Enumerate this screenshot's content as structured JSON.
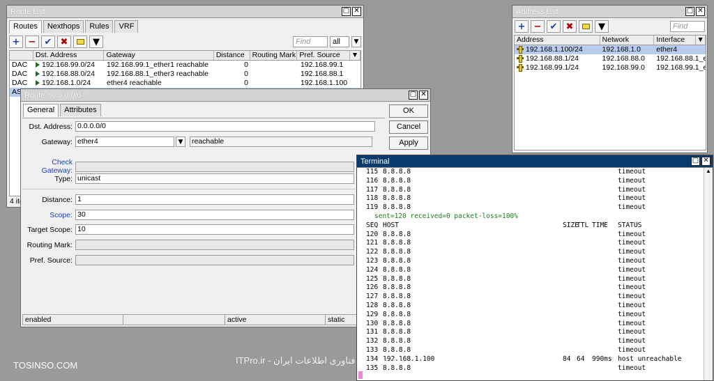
{
  "route_list": {
    "title": "Route List",
    "tabs": [
      "Routes",
      "Nexthops",
      "Rules",
      "VRF"
    ],
    "find_placeholder": "Find",
    "filter_value": "all",
    "columns": [
      "",
      "Dst. Address",
      "Gateway",
      "Distance",
      "Routing Mark",
      "Pref. Source"
    ],
    "rows": [
      {
        "flags": "DAC",
        "dst": "192.168.99.0/24",
        "gateway": "192.168.99.1_ether1 reachable",
        "distance": "0",
        "mark": "",
        "pref": "192.168.99.1"
      },
      {
        "flags": "DAC",
        "dst": "192.168.88.0/24",
        "gateway": "192.168.88.1_ether3 reachable",
        "distance": "0",
        "mark": "",
        "pref": "192.168.88.1"
      },
      {
        "flags": "DAC",
        "dst": "192.168.1.0/24",
        "gateway": "ether4 reachable",
        "distance": "0",
        "mark": "",
        "pref": "192.168.1.100"
      },
      {
        "flags": "AS",
        "dst": "",
        "gateway": "",
        "distance": "",
        "mark": "",
        "pref": ""
      }
    ],
    "item_count": "4 ite"
  },
  "route_dialog": {
    "title": "Route <0.0.0.0/0>",
    "tabs": [
      "General",
      "Attributes"
    ],
    "labels": {
      "dst": "Dst. Address:",
      "gateway": "Gateway:",
      "check_gateway": "Check Gateway:",
      "type": "Type:",
      "distance": "Distance:",
      "scope": "Scope:",
      "target_scope": "Target Scope:",
      "routing_mark": "Routing Mark:",
      "pref_source": "Pref. Source:"
    },
    "values": {
      "dst": "0.0.0.0/0",
      "gateway": "ether4",
      "gateway_state": "reachable",
      "type": "unicast",
      "distance": "1",
      "scope": "30",
      "target_scope": "10"
    },
    "buttons": {
      "ok": "OK",
      "cancel": "Cancel",
      "apply": "Apply"
    },
    "status": [
      "enabled",
      "",
      "active",
      "static"
    ]
  },
  "address_list": {
    "title": "Address List",
    "find_placeholder": "Find",
    "columns": [
      "Address",
      "Network",
      "Interface"
    ],
    "rows": [
      {
        "address": "192.168.1.100/24",
        "network": "192.168.1.0",
        "interface": "ether4"
      },
      {
        "address": "192.168.88.1/24",
        "network": "192.168.88.0",
        "interface": "192.168.88.1_e..."
      },
      {
        "address": "192.168.99.1/24",
        "network": "192.168.99.0",
        "interface": "192.168.99.1_e..."
      }
    ]
  },
  "terminal": {
    "title": "Terminal",
    "lines_before": [
      {
        "seq": "115",
        "host": "8.8.8.8",
        "status": "timeout"
      },
      {
        "seq": "116",
        "host": "8.8.8.8",
        "status": "timeout"
      },
      {
        "seq": "117",
        "host": "8.8.8.8",
        "status": "timeout"
      },
      {
        "seq": "118",
        "host": "8.8.8.8",
        "status": "timeout"
      },
      {
        "seq": "119",
        "host": "8.8.8.8",
        "status": "timeout"
      }
    ],
    "summary": "sent=120 received=0 packet-loss=100%",
    "header": {
      "seq": "SEQ",
      "host": "HOST",
      "size": "SIZE",
      "ttl": "TTL",
      "time": "TIME",
      "status": "STATUS"
    },
    "lines_after": [
      {
        "seq": "120",
        "host": "8.8.8.8",
        "size": "",
        "ttl": "",
        "time": "",
        "status": "timeout"
      },
      {
        "seq": "121",
        "host": "8.8.8.8",
        "size": "",
        "ttl": "",
        "time": "",
        "status": "timeout"
      },
      {
        "seq": "122",
        "host": "8.8.8.8",
        "size": "",
        "ttl": "",
        "time": "",
        "status": "timeout"
      },
      {
        "seq": "123",
        "host": "8.8.8.8",
        "size": "",
        "ttl": "",
        "time": "",
        "status": "timeout"
      },
      {
        "seq": "124",
        "host": "8.8.8.8",
        "size": "",
        "ttl": "",
        "time": "",
        "status": "timeout"
      },
      {
        "seq": "125",
        "host": "8.8.8.8",
        "size": "",
        "ttl": "",
        "time": "",
        "status": "timeout"
      },
      {
        "seq": "126",
        "host": "8.8.8.8",
        "size": "",
        "ttl": "",
        "time": "",
        "status": "timeout"
      },
      {
        "seq": "127",
        "host": "8.8.8.8",
        "size": "",
        "ttl": "",
        "time": "",
        "status": "timeout"
      },
      {
        "seq": "128",
        "host": "8.8.8.8",
        "size": "",
        "ttl": "",
        "time": "",
        "status": "timeout"
      },
      {
        "seq": "129",
        "host": "8.8.8.8",
        "size": "",
        "ttl": "",
        "time": "",
        "status": "timeout"
      },
      {
        "seq": "130",
        "host": "8.8.8.8",
        "size": "",
        "ttl": "",
        "time": "",
        "status": "timeout"
      },
      {
        "seq": "131",
        "host": "8.8.8.8",
        "size": "",
        "ttl": "",
        "time": "",
        "status": "timeout"
      },
      {
        "seq": "132",
        "host": "8.8.8.8",
        "size": "",
        "ttl": "",
        "time": "",
        "status": "timeout"
      },
      {
        "seq": "133",
        "host": "8.8.8.8",
        "size": "",
        "ttl": "",
        "time": "",
        "status": "timeout"
      },
      {
        "seq": "134",
        "host": "192.168.1.100",
        "size": "84",
        "ttl": "64",
        "time": "990ms",
        "status": "host unreachable"
      },
      {
        "seq": "135",
        "host": "8.8.8.8",
        "size": "",
        "ttl": "",
        "time": "",
        "status": "timeout"
      }
    ]
  },
  "watermarks": {
    "left": "TOSINSO.COM",
    "center": "مرجع تخصصی فناوری اطلاعات ایران - ITPro.ir"
  }
}
